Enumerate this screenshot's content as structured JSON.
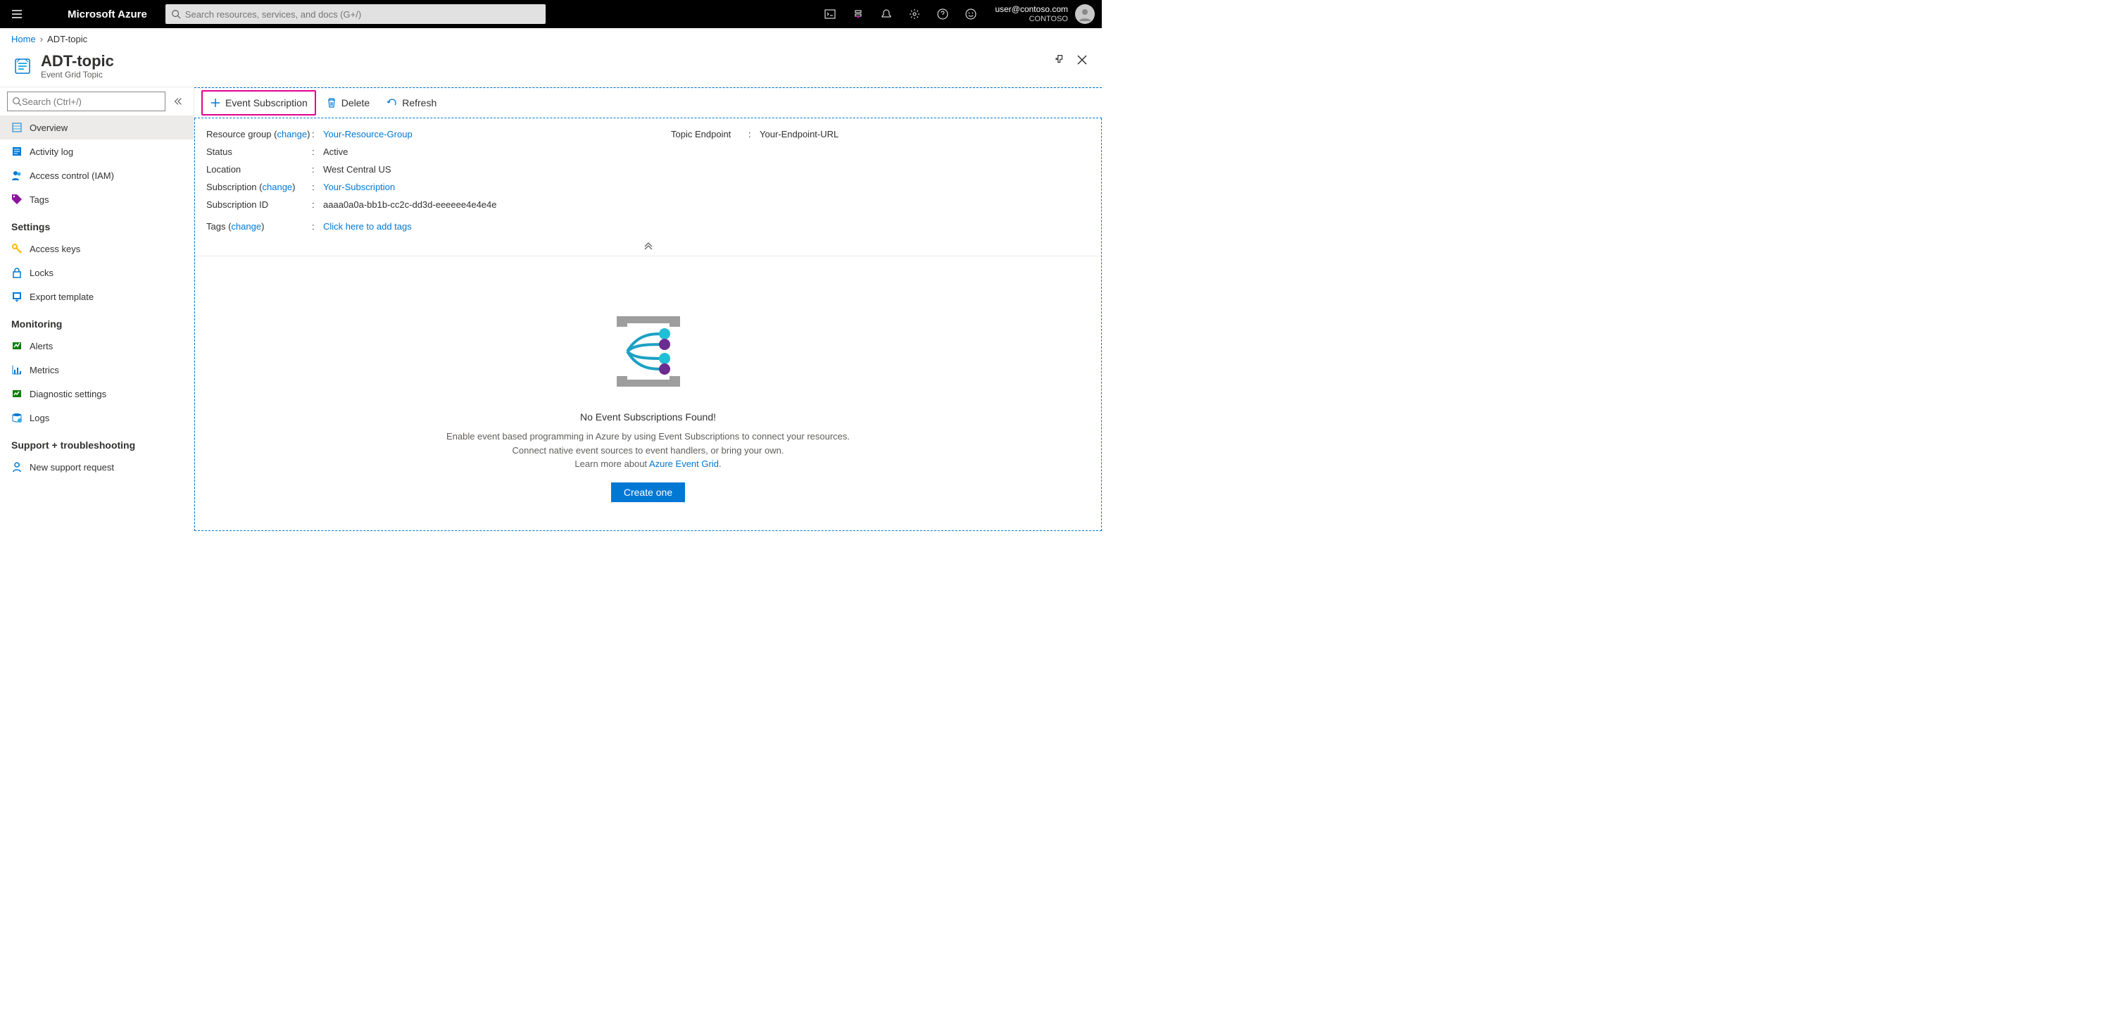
{
  "topbar": {
    "brand": "Microsoft Azure",
    "search_placeholder": "Search resources, services, and docs (G+/)",
    "account_email": "user@contoso.com",
    "account_tenant": "CONTOSO"
  },
  "breadcrumb": {
    "home": "Home",
    "current": "ADT-topic"
  },
  "header": {
    "title": "ADT-topic",
    "subtitle": "Event Grid Topic"
  },
  "sidebar": {
    "search_placeholder": "Search (Ctrl+/)",
    "items": {
      "overview": "Overview",
      "activity_log": "Activity log",
      "access_control": "Access control (IAM)",
      "tags": "Tags"
    },
    "sections": {
      "settings": "Settings",
      "monitoring": "Monitoring",
      "support": "Support + troubleshooting"
    },
    "settings_items": {
      "access_keys": "Access keys",
      "locks": "Locks",
      "export_template": "Export template"
    },
    "monitoring_items": {
      "alerts": "Alerts",
      "metrics": "Metrics",
      "diagnostic_settings": "Diagnostic settings",
      "logs": "Logs"
    },
    "support_items": {
      "new_support_request": "New support request"
    }
  },
  "cmdbar": {
    "event_subscription": "Event Subscription",
    "delete": "Delete",
    "refresh": "Refresh"
  },
  "essentials": {
    "resource_group_label": "Resource group",
    "change_text": "change",
    "resource_group_value": "Your-Resource-Group",
    "status_label": "Status",
    "status_value": "Active",
    "location_label": "Location",
    "location_value": "West Central US",
    "subscription_label": "Subscription",
    "subscription_value": "Your-Subscription",
    "subscription_id_label": "Subscription ID",
    "subscription_id_value": "aaaa0a0a-bb1b-cc2c-dd3d-eeeeee4e4e4e",
    "tags_label": "Tags",
    "tags_value": "Click here to add tags",
    "topic_endpoint_label": "Topic Endpoint",
    "topic_endpoint_value": "Your-Endpoint-URL"
  },
  "empty": {
    "title": "No Event Subscriptions Found!",
    "desc1": "Enable event based programming in Azure by using Event Subscriptions to connect your resources.",
    "desc2": "Connect native event sources to event handlers, or bring your own.",
    "desc3_prefix": "Learn more about ",
    "desc3_link": "Azure Event Grid",
    "button": "Create one"
  }
}
